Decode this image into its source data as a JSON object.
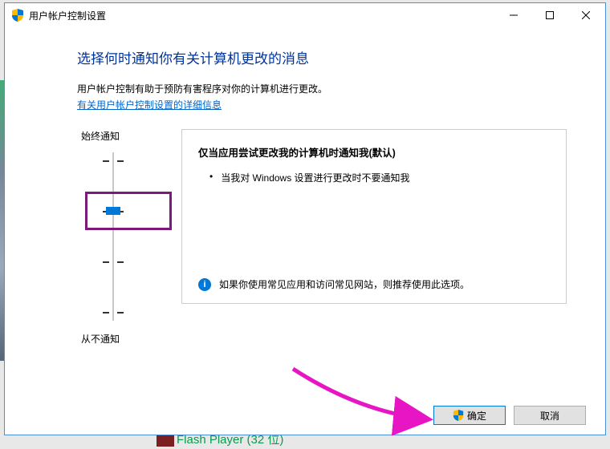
{
  "titlebar": {
    "title": "用户帐户控制设置"
  },
  "heading": "选择何时通知你有关计算机更改的消息",
  "description": "用户帐户控制有助于预防有害程序对你的计算机进行更改。",
  "link": "有关用户帐户控制设置的详细信息",
  "slider": {
    "labelTop": "始终通知",
    "labelBottom": "从不通知"
  },
  "infoBox": {
    "title": "仅当应用尝试更改我的计算机时通知我(默认)",
    "bullet": "当我对 Windows 设置进行更改时不要通知我",
    "recommendation": "如果你使用常见应用和访问常见网站，则推荐使用此选项。"
  },
  "buttons": {
    "ok": "确定",
    "cancel": "取消"
  },
  "bg": {
    "text": "Flash Player (32 位)"
  }
}
